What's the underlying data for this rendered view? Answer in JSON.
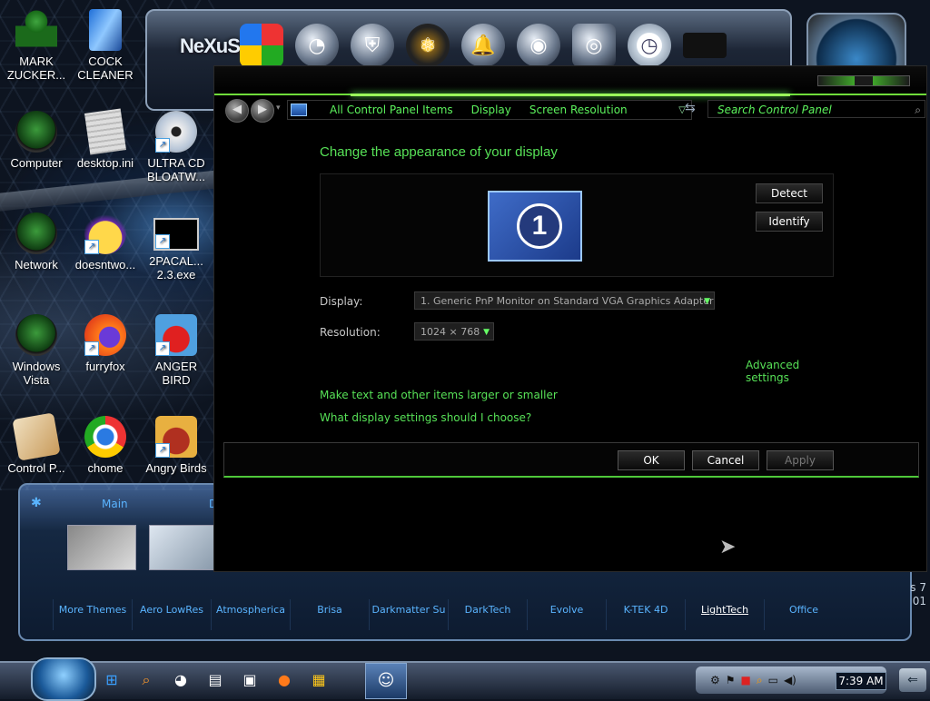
{
  "desktop_icons": [
    {
      "label": "MARK ZUCKER...",
      "icon": "figure-icon"
    },
    {
      "label": "COCK CLEANER",
      "icon": "ccleaner-icon"
    },
    {
      "label": "Computer",
      "icon": "computer-orb-icon"
    },
    {
      "label": "desktop.ini",
      "icon": "ini-file-icon"
    },
    {
      "label": "ULTRA CD BLOATW...",
      "icon": "cd-icon"
    },
    {
      "label": "Network",
      "icon": "network-orb-icon"
    },
    {
      "label": "doesntwo...",
      "icon": "yahoo-messenger-icon"
    },
    {
      "label": "2PACAL... 2.3.exe",
      "icon": "cmd-exe-icon"
    },
    {
      "label": "Windows Vista",
      "icon": "vista-orb-icon"
    },
    {
      "label": "furryfox",
      "icon": "firefox-icon"
    },
    {
      "label": "ANGER BIRD",
      "icon": "angry-bird-icon"
    },
    {
      "label": "Control P...",
      "icon": "control-panel-icon"
    },
    {
      "label": "chome",
      "icon": "chrome-icon"
    },
    {
      "label": "Angry Birds",
      "icon": "angry-birds-seasons-icon"
    }
  ],
  "dock": {
    "logo": "NeXuS"
  },
  "window": {
    "breadcrumbs": [
      "All Control Panel Items",
      "Display",
      "Screen Resolution"
    ],
    "search_placeholder": "Search Control Panel",
    "heading": "Change the appearance of your display",
    "monitor_number": "1",
    "detect_label": "Detect",
    "identify_label": "Identify",
    "display_label": "Display:",
    "display_value": "1. Generic PnP Monitor on Standard VGA Graphics Adapter",
    "resolution_label": "Resolution:",
    "resolution_value": "1024 × 768",
    "advanced_link": "Advanced settings",
    "link_text_size": "Make text and other items larger or smaller",
    "link_help": "What display settings should I choose?",
    "ok_label": "OK",
    "cancel_label": "Cancel",
    "apply_label": "Apply"
  },
  "themes_panel": {
    "tab_main": "Main",
    "tab_d": "D",
    "themes": [
      "More Themes",
      "Aero LowRes",
      "Atmospherica",
      "Brisa",
      "Darkmatter Su",
      "DarkTech",
      "Evolve",
      "K-TEK 4D",
      "LightTech",
      "Office"
    ],
    "active_theme": "LightTech"
  },
  "watermark": {
    "line1": "s 7",
    "line2": "01"
  },
  "taskbar": {
    "clock": "7:39 AM"
  },
  "colors": {
    "accent_green": "#57e157",
    "link_blue": "#5ab4ff"
  }
}
